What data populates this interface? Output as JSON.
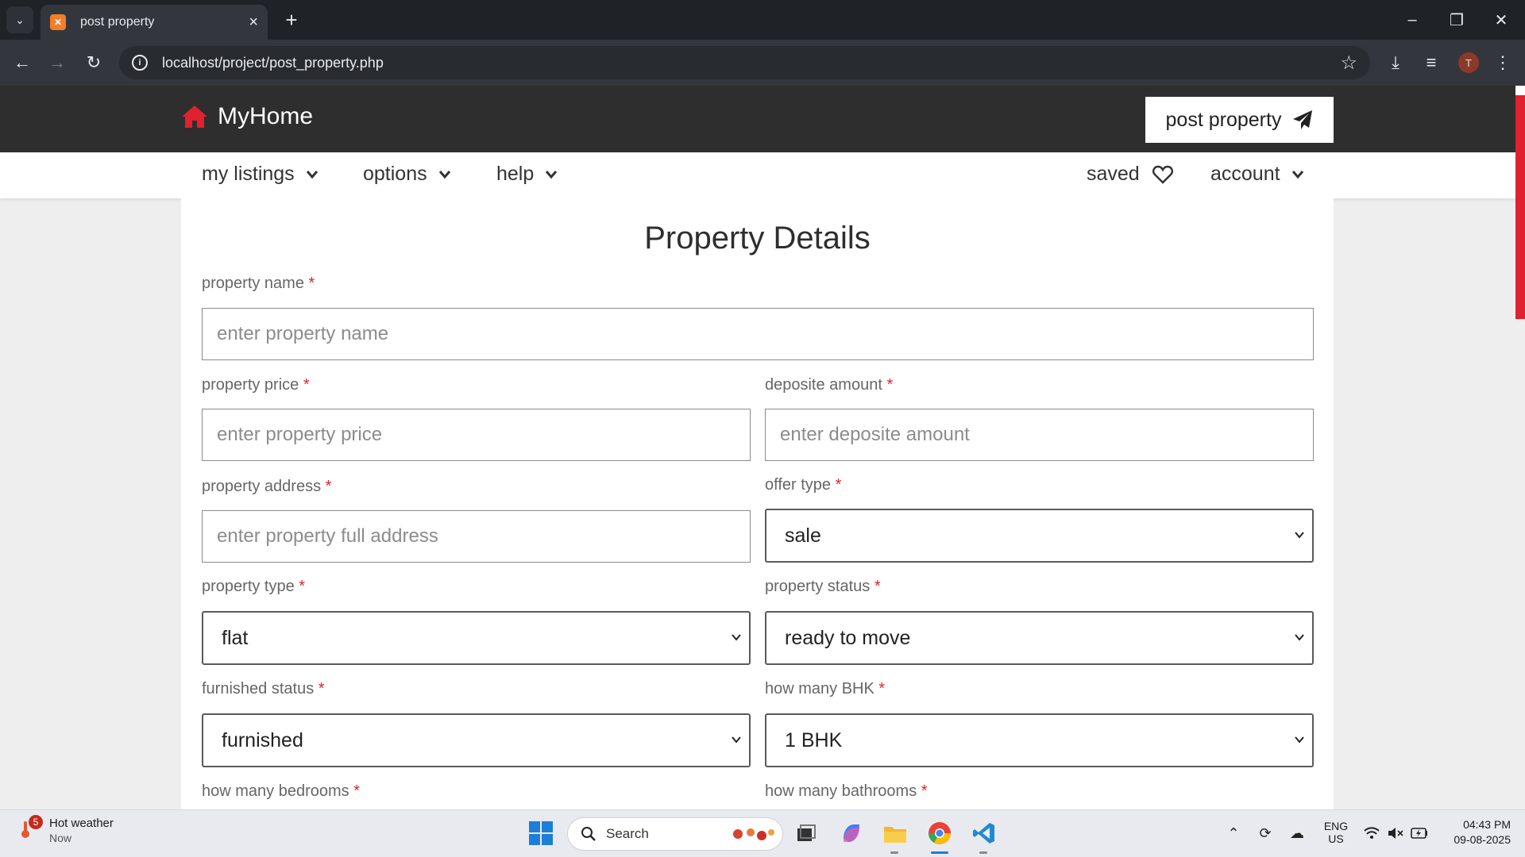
{
  "browser": {
    "tab_title": "post property",
    "url": "localhost/project/post_property.php",
    "profile_initial": "T"
  },
  "site": {
    "logo_text": "MyHome",
    "post_button_label": "post property",
    "nav": {
      "my_listings": "my listings",
      "options": "options",
      "help": "help",
      "saved": "saved",
      "account": "account"
    },
    "brand_color": "#e0212f"
  },
  "form": {
    "title": "Property Details",
    "required_mark": "*",
    "property_name": {
      "label": "property name",
      "placeholder": "enter property name"
    },
    "property_price": {
      "label": "property price",
      "placeholder": "enter property price"
    },
    "deposite_amount": {
      "label": "deposite amount",
      "placeholder": "enter deposite amount"
    },
    "property_address": {
      "label": "property address",
      "placeholder": "enter property full address"
    },
    "offer_type": {
      "label": "offer type",
      "value": "sale"
    },
    "property_type": {
      "label": "property type",
      "value": "flat"
    },
    "property_status": {
      "label": "property status",
      "value": "ready to move"
    },
    "furnished_status": {
      "label": "furnished status",
      "value": "furnished"
    },
    "bhk": {
      "label": "how many BHK",
      "value": "1 BHK"
    },
    "bedrooms": {
      "label": "how many bedrooms"
    },
    "bathrooms": {
      "label": "how many bathrooms"
    }
  },
  "taskbar": {
    "weather_title": "Hot weather",
    "weather_sub": "Now",
    "weather_badge": "5",
    "search_label": "Search",
    "language_top": "ENG",
    "language_bottom": "US",
    "time": "04:43 PM",
    "date": "09-08-2025"
  }
}
